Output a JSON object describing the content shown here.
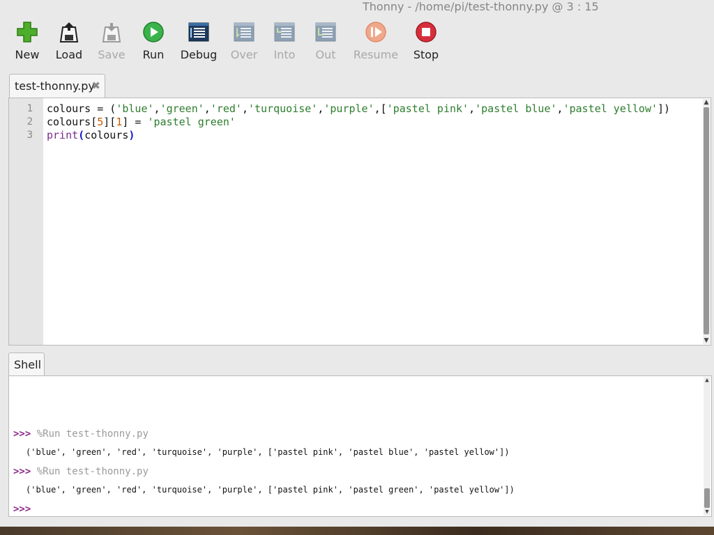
{
  "window": {
    "title": "Thonny  -  /home/pi/test-thonny.py  @  3 : 15"
  },
  "toolbar": {
    "buttons": [
      {
        "label": "New",
        "icon": "new-icon",
        "enabled": true
      },
      {
        "label": "Load",
        "icon": "load-icon",
        "enabled": true
      },
      {
        "label": "Save",
        "icon": "save-icon",
        "enabled": false
      },
      {
        "label": "Run",
        "icon": "run-icon",
        "enabled": true
      },
      {
        "label": "Debug",
        "icon": "debug-icon",
        "enabled": true
      },
      {
        "label": "Over",
        "icon": "step-over-icon",
        "enabled": false
      },
      {
        "label": "Into",
        "icon": "step-into-icon",
        "enabled": false
      },
      {
        "label": "Out",
        "icon": "step-out-icon",
        "enabled": false
      },
      {
        "label": "Resume",
        "icon": "resume-icon",
        "enabled": false
      },
      {
        "label": "Stop",
        "icon": "stop-icon",
        "enabled": true
      }
    ]
  },
  "editor": {
    "tab_label": "test-thonny.py",
    "line_numbers": [
      "1",
      "2",
      "3"
    ],
    "lines": [
      "colours = ('blue','green','red','turquoise','purple',['pastel pink','pastel blue','pastel yellow'])",
      "colours[5][1] = 'pastel green'",
      "print(colours)"
    ]
  },
  "shell": {
    "tab_label": "Shell",
    "prompt": ">>>",
    "entries": [
      {
        "command": "%Run test-thonny.py",
        "output": "('blue', 'green', 'red', 'turquoise', 'purple', ['pastel pink', 'pastel blue', 'pastel yellow'])"
      },
      {
        "command": "%Run test-thonny.py",
        "output": "('blue', 'green', 'red', 'turquoise', 'purple', ['pastel pink', 'pastel green', 'pastel yellow'])"
      }
    ]
  },
  "colors": {
    "string": "#2d7d2d",
    "number": "#c25a00",
    "builtin": "#7a2b8a",
    "prompt": "#8a2b8a",
    "disabled_label": "#a8a8a8"
  }
}
